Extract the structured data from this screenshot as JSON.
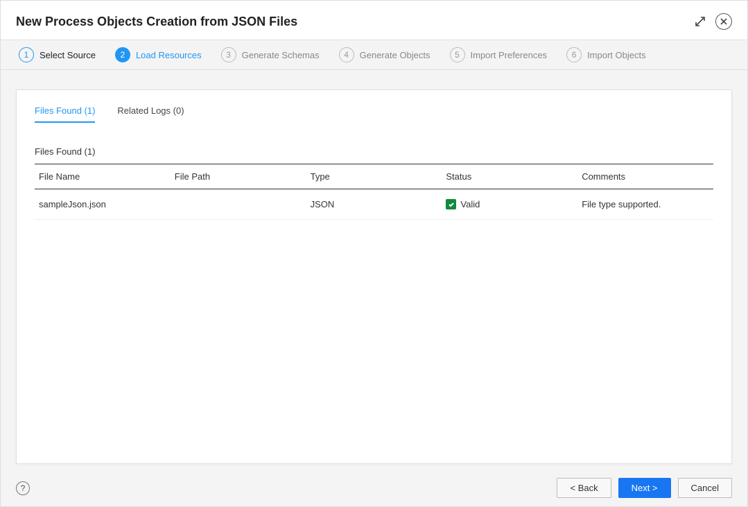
{
  "dialog": {
    "title": "New Process Objects Creation from JSON Files"
  },
  "wizard": {
    "steps": [
      {
        "num": "1",
        "label": "Select Source",
        "state": "completed"
      },
      {
        "num": "2",
        "label": "Load Resources",
        "state": "active"
      },
      {
        "num": "3",
        "label": "Generate Schemas",
        "state": "pending"
      },
      {
        "num": "4",
        "label": "Generate Objects",
        "state": "pending"
      },
      {
        "num": "5",
        "label": "Import Preferences",
        "state": "pending"
      },
      {
        "num": "6",
        "label": "Import Objects",
        "state": "pending"
      }
    ]
  },
  "tabs": {
    "files_found": "Files Found (1)",
    "related_logs": "Related Logs (0)"
  },
  "section": {
    "title": "Files Found (1)"
  },
  "table": {
    "headers": {
      "file_name": "File Name",
      "file_path": "File Path",
      "type": "Type",
      "status": "Status",
      "comments": "Comments"
    },
    "rows": [
      {
        "file_name": "sampleJson.json",
        "file_path": "",
        "type": "JSON",
        "status": "Valid",
        "comments": "File type supported."
      }
    ]
  },
  "footer": {
    "back": "< Back",
    "next": "Next >",
    "cancel": "Cancel"
  }
}
